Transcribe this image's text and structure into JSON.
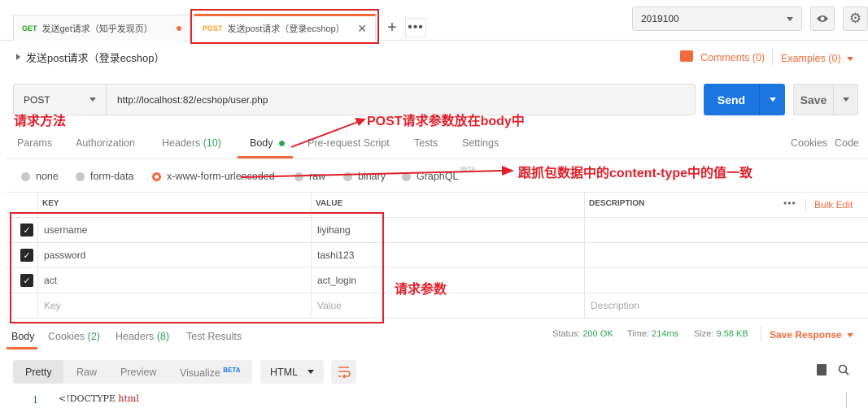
{
  "tabs": [
    {
      "method": "GET",
      "title": "发送get请求（知乎发现页）",
      "method_color": "#20a020"
    },
    {
      "method": "POST",
      "title": "发送post请求（登录ecshop）",
      "method_color": "#f5a623"
    }
  ],
  "environment": {
    "selected": "2019100"
  },
  "breadcrumb": "发送post请求（登录ecshop）",
  "comments_label": "Comments (0)",
  "examples_label": "Examples (0)",
  "request": {
    "method": "POST",
    "url": "http://localhost:82/ecshop/user.php",
    "send_label": "Send",
    "save_label": "Save"
  },
  "request_tabs": {
    "params": "Params",
    "authorization": "Authorization",
    "headers": "Headers",
    "headers_count": "(10)",
    "body": "Body",
    "prerequest": "Pre-request Script",
    "tests": "Tests",
    "settings": "Settings",
    "cookies": "Cookies",
    "code": "Code"
  },
  "body_types": [
    {
      "label": "none",
      "selected": false
    },
    {
      "label": "form-data",
      "selected": false
    },
    {
      "label": "x-www-form-urlencoded",
      "selected": true
    },
    {
      "label": "raw",
      "selected": false
    },
    {
      "label": "binary",
      "selected": false
    },
    {
      "label": "GraphQL",
      "selected": false
    }
  ],
  "beta_small": "BETA",
  "table": {
    "headers": {
      "key": "KEY",
      "value": "VALUE",
      "description": "DESCRIPTION"
    },
    "bulk_edit": "Bulk Edit",
    "rows": [
      {
        "key": "username",
        "value": "liyihang",
        "checked": true
      },
      {
        "key": "password",
        "value": "tashi123",
        "checked": true
      },
      {
        "key": "act",
        "value": "act_login",
        "checked": true
      }
    ],
    "placeholder": {
      "key": "Key",
      "value": "Value",
      "description": "Description"
    }
  },
  "response_tabs": {
    "body": "Body",
    "cookies": "Cookies",
    "cookies_count": "(2)",
    "headers": "Headers",
    "headers_count": "(8)",
    "test_results": "Test Results"
  },
  "response_meta": {
    "status_label": "Status:",
    "status_value": "200 OK",
    "time_label": "Time:",
    "time_value": "214ms",
    "size_label": "Size:",
    "size_value": "9.58 KB",
    "save_response": "Save Response"
  },
  "format": {
    "pretty": "Pretty",
    "raw": "Raw",
    "preview": "Preview",
    "visualize": "Visualize",
    "beta": "BETA",
    "language": "HTML"
  },
  "code": {
    "line_no": "1",
    "text_prefix": "<!DOCTYPE ",
    "text_tag": "html"
  },
  "annotations": {
    "method": "请求方法",
    "body_note": "POST请求参数放在body中",
    "content_type_note": "跟抓包数据中的content-type中的值一致",
    "params_note": "请求参数"
  },
  "colors": {
    "accent": "#f26b3a",
    "send": "#1b76e2",
    "annotation": "#e0202a",
    "ok": "#2ea44f"
  }
}
